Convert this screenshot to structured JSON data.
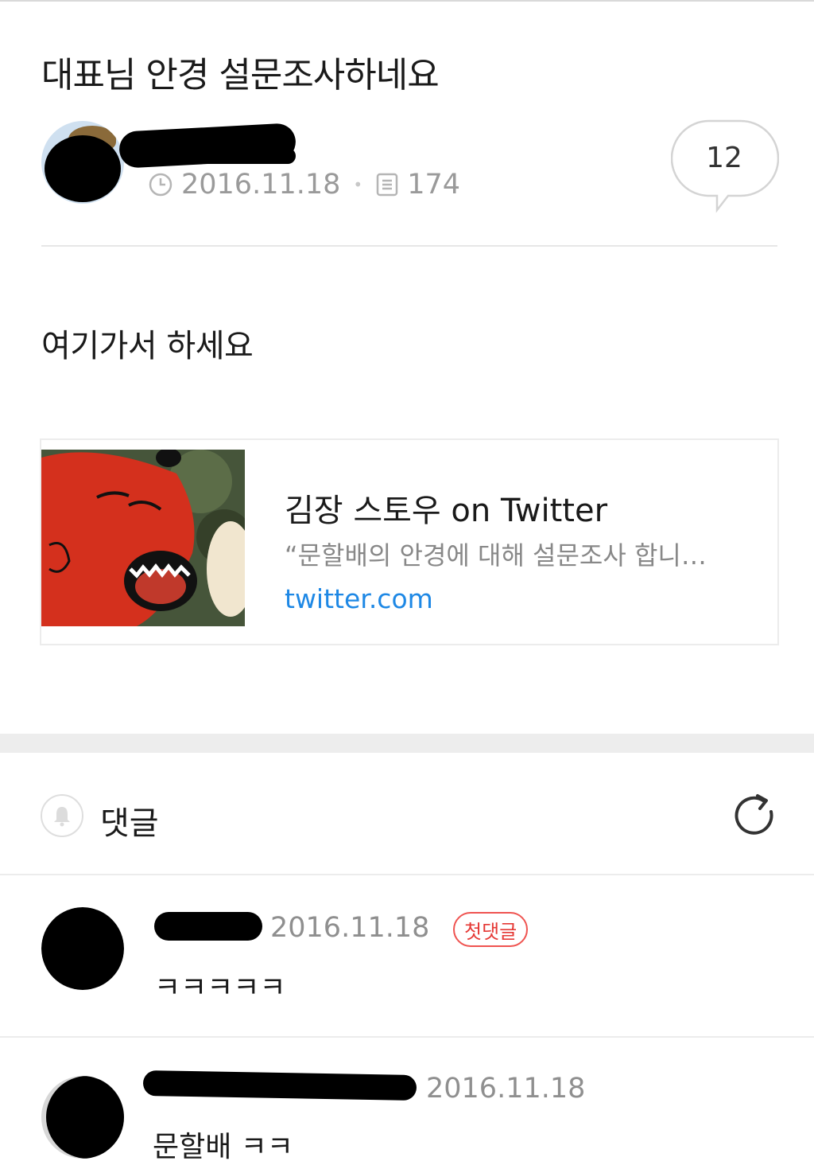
{
  "post": {
    "title": "대표님 안경 설문조사하네요",
    "date": "2016.11.18",
    "views": "174",
    "comment_count": "12",
    "body": "여기가서 하세요"
  },
  "link_card": {
    "title": "김장 스토우 on Twitter",
    "description": "“문할배의 안경에 대해 설문조사 합니…",
    "domain": "twitter.com"
  },
  "comments_section": {
    "heading": "댓글",
    "items": [
      {
        "date": "2016.11.18",
        "badge": "첫댓글",
        "text": "ㅋㅋㅋㅋㅋ"
      },
      {
        "date": "2016.11.18",
        "text": "문할배 ㅋㅋ"
      }
    ]
  },
  "colors": {
    "accent": "#1e88e5",
    "badge": "#e53935",
    "meta": "#9a9a9a"
  },
  "icons": [
    "clock-icon",
    "document-icon",
    "speech-bubble-icon",
    "bell-icon",
    "refresh-icon"
  ]
}
